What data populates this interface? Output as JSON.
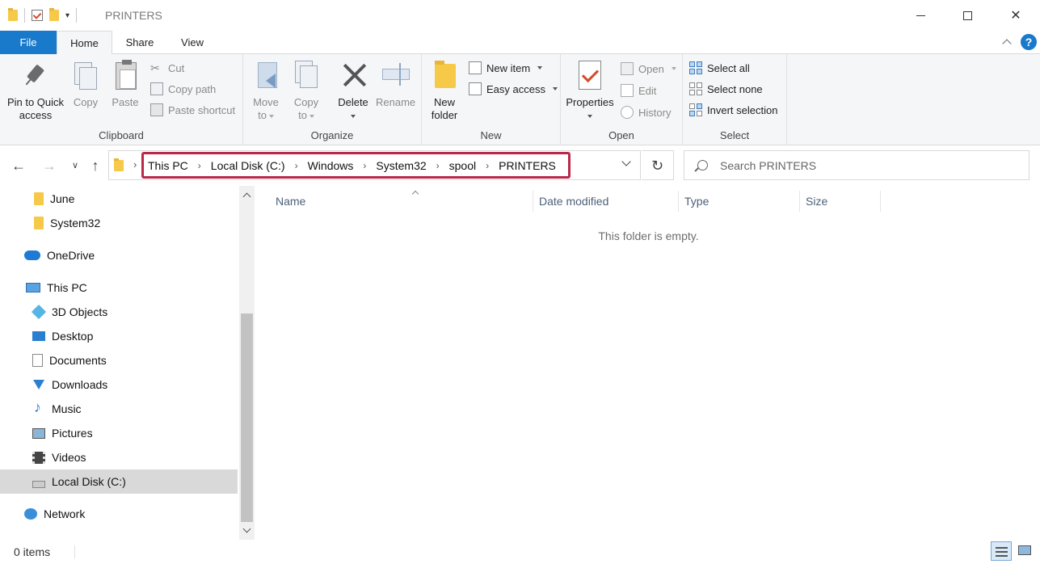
{
  "window": {
    "title": "PRINTERS"
  },
  "ribbon_tabs": {
    "file": "File",
    "home": "Home",
    "share": "Share",
    "view": "View"
  },
  "help_label": "?",
  "clipboard": {
    "group_label": "Clipboard",
    "pin_line1": "Pin to Quick",
    "pin_line2": "access",
    "copy": "Copy",
    "paste": "Paste",
    "cut": "Cut",
    "copy_path": "Copy path",
    "paste_shortcut": "Paste shortcut"
  },
  "organize": {
    "group_label": "Organize",
    "move_to_line1": "Move",
    "move_to_line2": "to",
    "copy_to_line1": "Copy",
    "copy_to_line2": "to",
    "delete": "Delete",
    "rename": "Rename"
  },
  "new": {
    "group_label": "New",
    "new_folder_line1": "New",
    "new_folder_line2": "folder",
    "new_item": "New item",
    "easy_access": "Easy access"
  },
  "open": {
    "group_label": "Open",
    "properties": "Properties",
    "open": "Open",
    "edit": "Edit",
    "history": "History"
  },
  "select": {
    "group_label": "Select",
    "select_all": "Select all",
    "select_none": "Select none",
    "invert_selection": "Invert selection"
  },
  "address": {
    "crumbs": [
      "This PC",
      "Local Disk (C:)",
      "Windows",
      "System32",
      "spool",
      "PRINTERS"
    ]
  },
  "search": {
    "placeholder": "Search PRINTERS"
  },
  "nav_pane": {
    "items": [
      {
        "label": "June",
        "icon": "folder-icon"
      },
      {
        "label": "System32",
        "icon": "folder-icon"
      },
      {
        "label": "OneDrive",
        "icon": "onedrive-icon"
      },
      {
        "label": "This PC",
        "icon": "this-pc-icon"
      },
      {
        "label": "3D Objects",
        "icon": "3d-objects-icon"
      },
      {
        "label": "Desktop",
        "icon": "desktop-icon"
      },
      {
        "label": "Documents",
        "icon": "documents-icon"
      },
      {
        "label": "Downloads",
        "icon": "downloads-icon"
      },
      {
        "label": "Music",
        "icon": "music-icon"
      },
      {
        "label": "Pictures",
        "icon": "pictures-icon"
      },
      {
        "label": "Videos",
        "icon": "videos-icon"
      },
      {
        "label": "Local Disk (C:)",
        "icon": "local-disk-icon",
        "selected": true
      },
      {
        "label": "Network",
        "icon": "network-icon"
      }
    ]
  },
  "columns": {
    "name": "Name",
    "date_modified": "Date modified",
    "type": "Type",
    "size": "Size"
  },
  "content": {
    "empty_message": "This folder is empty."
  },
  "status": {
    "item_count": "0 items"
  },
  "colors": {
    "accent": "#1979ca",
    "highlight_border": "#b8294a",
    "selected_bg": "#d9d9d9"
  }
}
